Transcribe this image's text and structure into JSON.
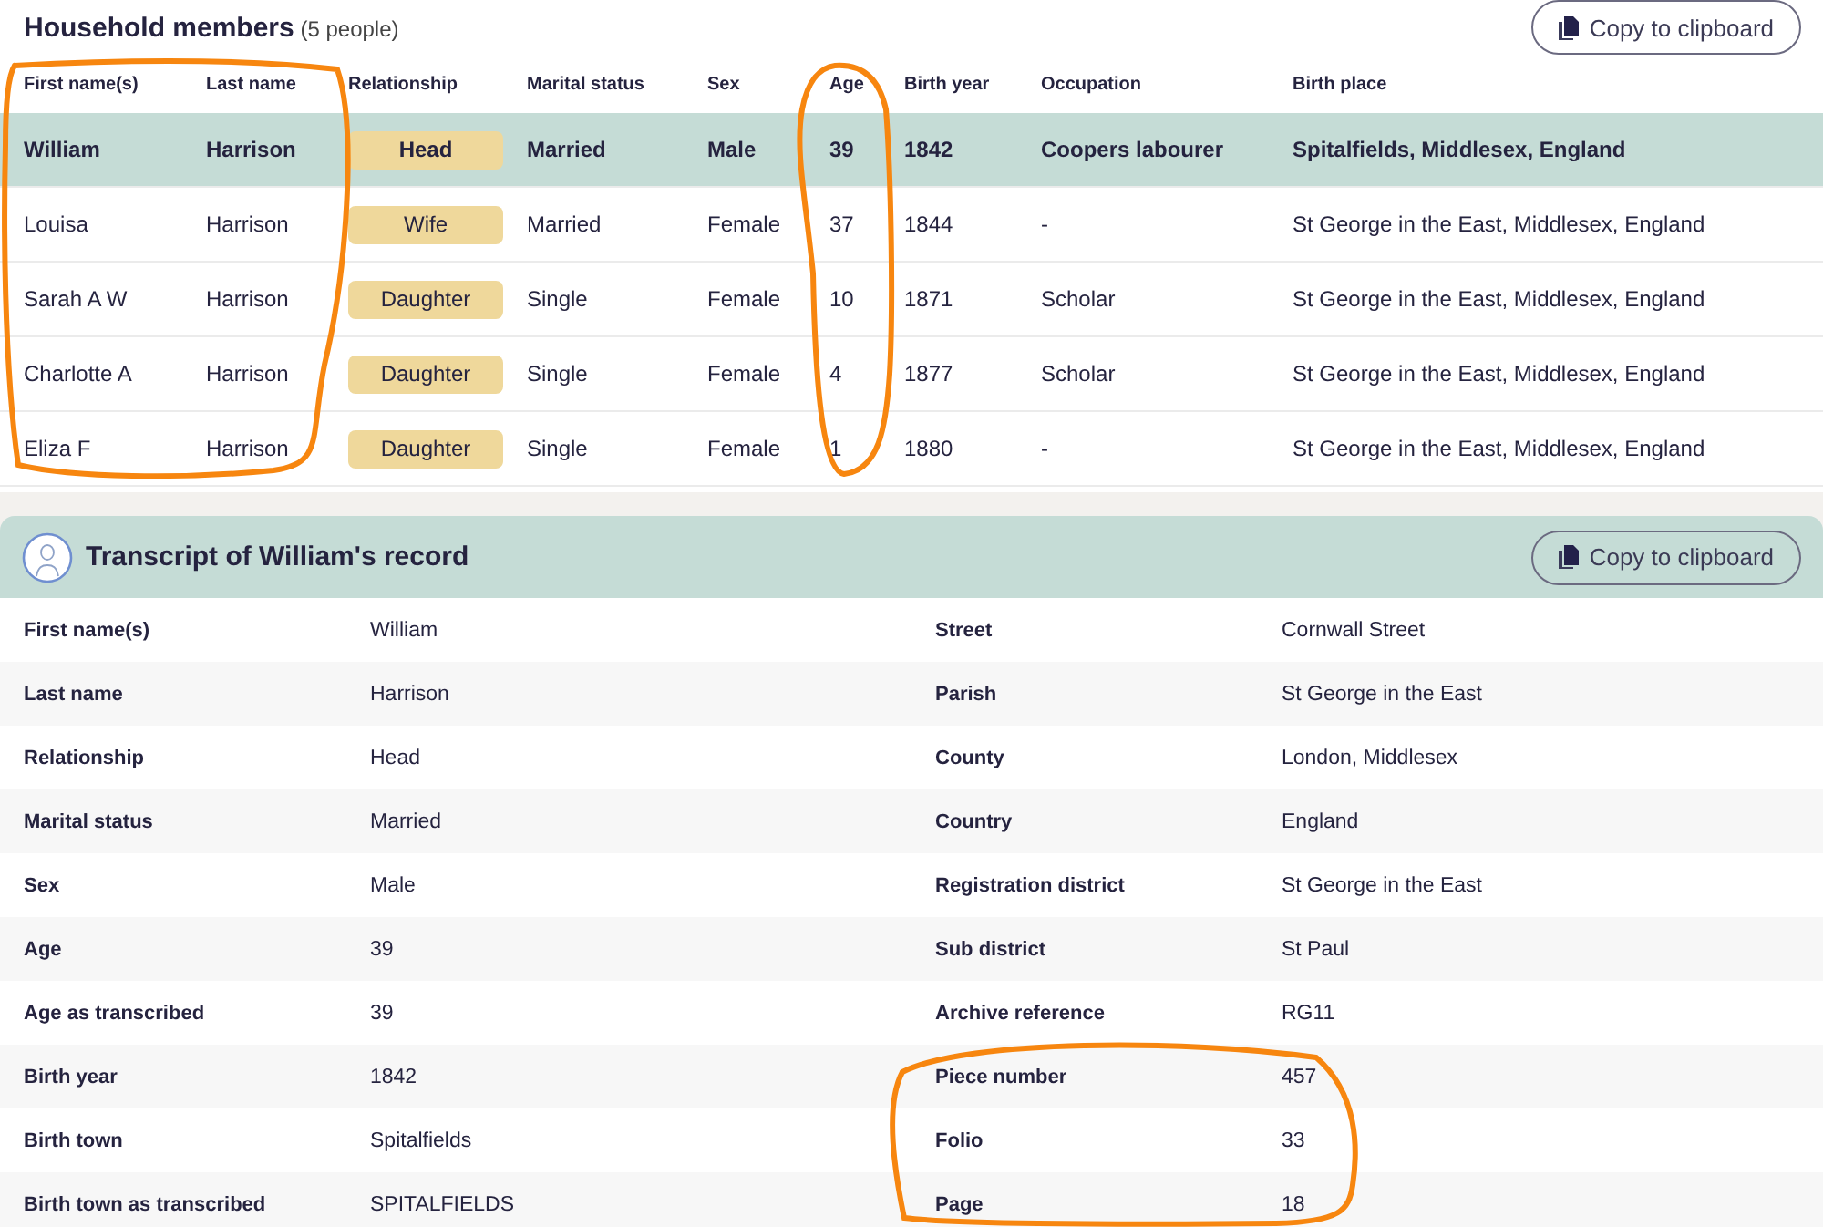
{
  "household": {
    "title": "Household members",
    "count": "(5 people)",
    "copy_button": "Copy to clipboard",
    "columns": [
      "First name(s)",
      "Last name",
      "Relationship",
      "Marital status",
      "Sex",
      "Age",
      "Birth year",
      "Occupation",
      "Birth place"
    ],
    "rows": [
      {
        "selected": true,
        "cells": [
          "William",
          "Harrison",
          "Head",
          "Married",
          "Male",
          "39",
          "1842",
          "Coopers labourer",
          "Spitalfields, Middlesex, England"
        ]
      },
      {
        "selected": false,
        "cells": [
          "Louisa",
          "Harrison",
          "Wife",
          "Married",
          "Female",
          "37",
          "1844",
          "-",
          "St George in the East, Middlesex, England"
        ]
      },
      {
        "selected": false,
        "cells": [
          "Sarah A W",
          "Harrison",
          "Daughter",
          "Single",
          "Female",
          "10",
          "1871",
          "Scholar",
          "St George in the East, Middlesex, England"
        ]
      },
      {
        "selected": false,
        "cells": [
          "Charlotte A",
          "Harrison",
          "Daughter",
          "Single",
          "Female",
          "4",
          "1877",
          "Scholar",
          "St George in the East, Middlesex, England"
        ]
      },
      {
        "selected": false,
        "cells": [
          "Eliza F",
          "Harrison",
          "Daughter",
          "Single",
          "Female",
          "1",
          "1880",
          "-",
          "St George in the East, Middlesex, England"
        ]
      }
    ]
  },
  "transcript": {
    "title": "Transcript of William's record",
    "copy_button": "Copy to clipboard",
    "rows": [
      {
        "left": {
          "label": "First name(s)",
          "value": "William"
        },
        "right": {
          "label": "Street",
          "value": "Cornwall Street"
        }
      },
      {
        "left": {
          "label": "Last name",
          "value": "Harrison"
        },
        "right": {
          "label": "Parish",
          "value": "St George in the East"
        }
      },
      {
        "left": {
          "label": "Relationship",
          "value": "Head"
        },
        "right": {
          "label": "County",
          "value": "London, Middlesex"
        }
      },
      {
        "left": {
          "label": "Marital status",
          "value": "Married"
        },
        "right": {
          "label": "Country",
          "value": "England"
        }
      },
      {
        "left": {
          "label": "Sex",
          "value": "Male"
        },
        "right": {
          "label": "Registration district",
          "value": "St George in the East"
        }
      },
      {
        "left": {
          "label": "Age",
          "value": "39"
        },
        "right": {
          "label": "Sub district",
          "value": "St Paul"
        }
      },
      {
        "left": {
          "label": "Age as transcribed",
          "value": "39"
        },
        "right": {
          "label": "Archive reference",
          "value": "RG11"
        }
      },
      {
        "left": {
          "label": "Birth year",
          "value": "1842"
        },
        "right": {
          "label": "Piece number",
          "value": "457"
        }
      },
      {
        "left": {
          "label": "Birth town",
          "value": "Spitalfields"
        },
        "right": {
          "label": "Folio",
          "value": "33"
        }
      },
      {
        "left": {
          "label": "Birth town as transcribed",
          "value": "SPITALFIELDS"
        },
        "right": {
          "label": "Page",
          "value": "18"
        }
      }
    ]
  }
}
